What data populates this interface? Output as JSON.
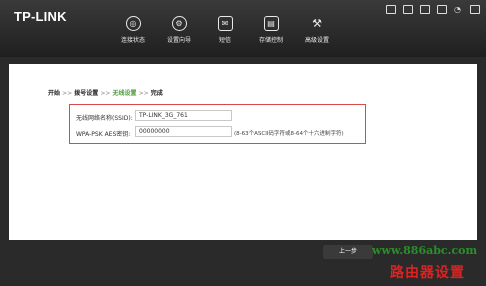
{
  "brand": "TP-LINK",
  "nav": [
    {
      "label": "连接状态",
      "icon": "globe-icon"
    },
    {
      "label": "设置向导",
      "icon": "gear-icon"
    },
    {
      "label": "短信",
      "icon": "mail-icon"
    },
    {
      "label": "存储控制",
      "icon": "storage-icon"
    },
    {
      "label": "高级设置",
      "icon": "tools-icon"
    }
  ],
  "breadcrumb": {
    "step1": "开始",
    "sep": ">>",
    "step2": "拨号设置",
    "step3": "无线设置",
    "step4": "完成"
  },
  "form": {
    "ssid_label": "无线网络名称(SSID):",
    "ssid_value": "TP-LINK_3G_761",
    "key_label": "WPA-PSK AES密钥:",
    "key_value": "00000000",
    "key_hint": "(8-63个ASCII码字符或8-64个十六进制字符)"
  },
  "buttons": {
    "prev": "上一步"
  },
  "watermark": {
    "url": "www.886abc.com",
    "text": "路由器设置"
  },
  "colors": {
    "accent_current_step": "#4f9a3d",
    "highlight_box": "#d94a4a"
  }
}
